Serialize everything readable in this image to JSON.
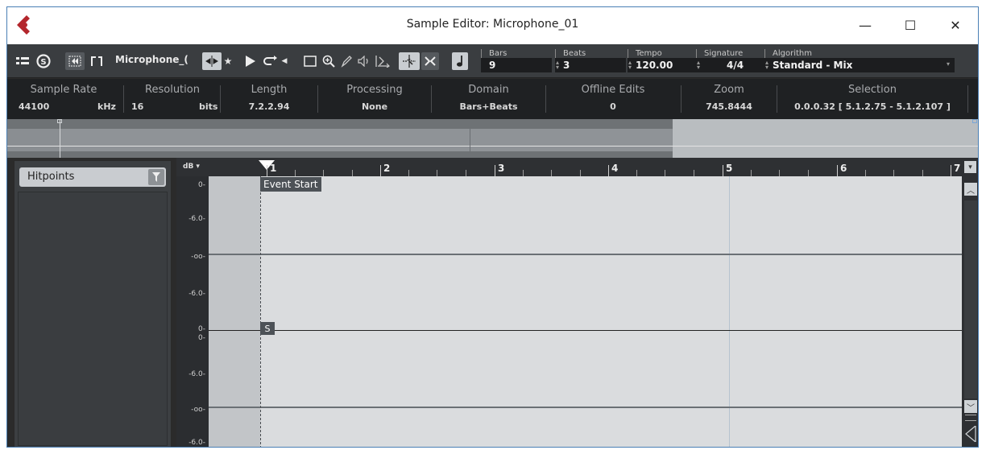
{
  "window": {
    "title": "Sample Editor: Microphone_01",
    "controls": {
      "minimize": "—",
      "maximize": "☐",
      "close": "✕"
    }
  },
  "toolbar": {
    "track_name": "Microphone_(",
    "bars": {
      "label": "Bars",
      "value": "9"
    },
    "beats": {
      "label": "Beats",
      "value": "3"
    },
    "tempo": {
      "label": "Tempo",
      "value": "120.00"
    },
    "signature": {
      "label": "Signature",
      "value": "4/4"
    },
    "algorithm": {
      "label": "Algorithm",
      "value": "Standard - Mix"
    }
  },
  "infoline": {
    "sample_rate": {
      "header": "Sample Rate",
      "value": "44100",
      "unit": "kHz"
    },
    "resolution": {
      "header": "Resolution",
      "value": "16",
      "unit": "bits"
    },
    "length": {
      "header": "Length",
      "value": "7.2.2.94"
    },
    "processing": {
      "header": "Processing",
      "value": "None"
    },
    "domain": {
      "header": "Domain",
      "value": "Bars+Beats"
    },
    "offline_edits": {
      "header": "Offline Edits",
      "value": "0"
    },
    "zoom": {
      "header": "Zoom",
      "value": "745.8444"
    },
    "selection": {
      "header": "Selection",
      "value": "0.0.0.32 [ 5.1.2.75 - 5.1.2.107 ]"
    }
  },
  "left_panel": {
    "hitpoints_label": "Hitpoints"
  },
  "ruler": {
    "db_label": "dB ▾",
    "bars": [
      "1",
      "2",
      "3",
      "4",
      "5",
      "6",
      "7"
    ]
  },
  "db_scale": {
    "channel1": [
      "0-",
      "-6.0-",
      "-oo-",
      "-6.0-"
    ],
    "channel2": [
      "0-",
      "0-",
      "-6.0-",
      "-oo-",
      "-6.0-"
    ]
  },
  "waveform": {
    "event_start_label": "Event Start",
    "start_marker_label": "S"
  },
  "colors": {
    "accent_logo": "#b3262c",
    "waveform_bg": "#dadcde",
    "toolbar_bg": "#3a3d40"
  }
}
